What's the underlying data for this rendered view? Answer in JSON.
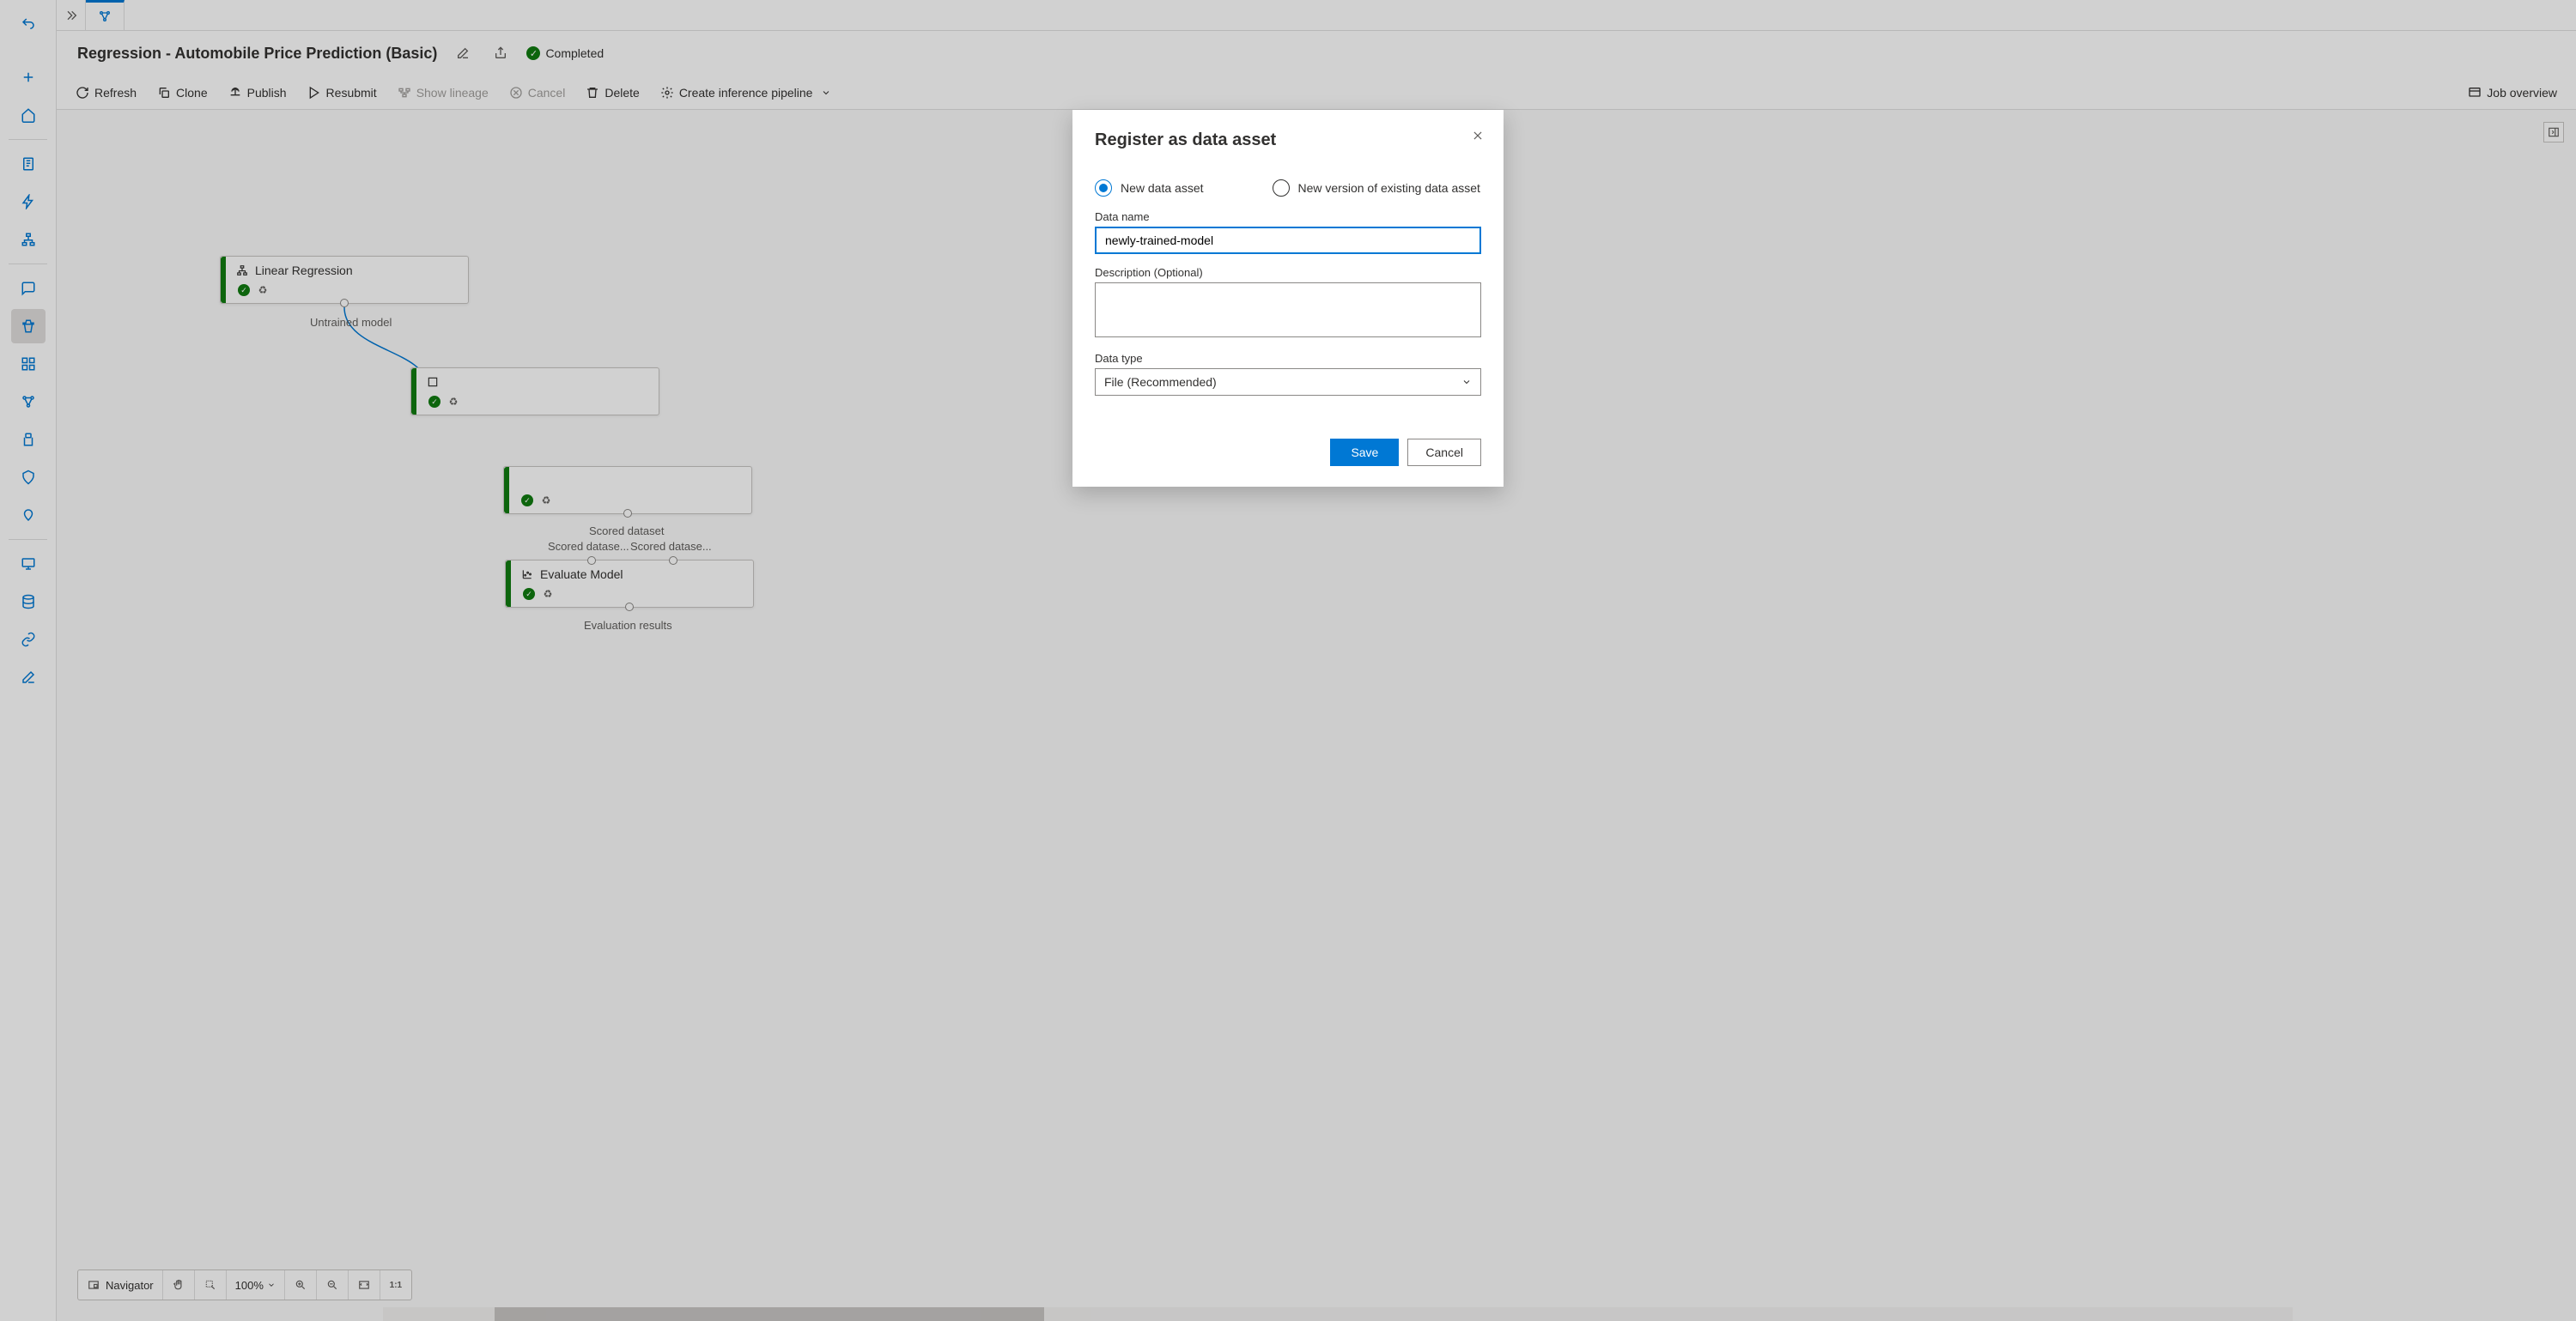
{
  "header": {
    "title": "Regression - Automobile Price Prediction (Basic)",
    "status": "Completed"
  },
  "toolbar": {
    "refresh": "Refresh",
    "clone": "Clone",
    "publish": "Publish",
    "resubmit": "Resubmit",
    "show_lineage": "Show lineage",
    "cancel": "Cancel",
    "delete": "Delete",
    "create_inference": "Create inference pipeline",
    "job_overview": "Job overview"
  },
  "canvas": {
    "nodes": {
      "linear_regression": "Linear Regression",
      "evaluate_model": "Evaluate Model"
    },
    "labels": {
      "untrained_model": "Untrained model",
      "scored_dataset": "Scored dataset",
      "scored_left": "Scored datase...",
      "scored_right": "Scored datase...",
      "evaluation_results": "Evaluation results"
    }
  },
  "nav": {
    "navigator": "Navigator",
    "zoom": "100%"
  },
  "dialog": {
    "title": "Register as data asset",
    "radio_new": "New data asset",
    "radio_existing": "New version of existing data asset",
    "data_name_label": "Data name",
    "data_name_value": "newly-trained-model",
    "desc_label": "Description (Optional)",
    "desc_value": "",
    "type_label": "Data type",
    "type_value": "File (Recommended)",
    "save": "Save",
    "cancel": "Cancel"
  }
}
